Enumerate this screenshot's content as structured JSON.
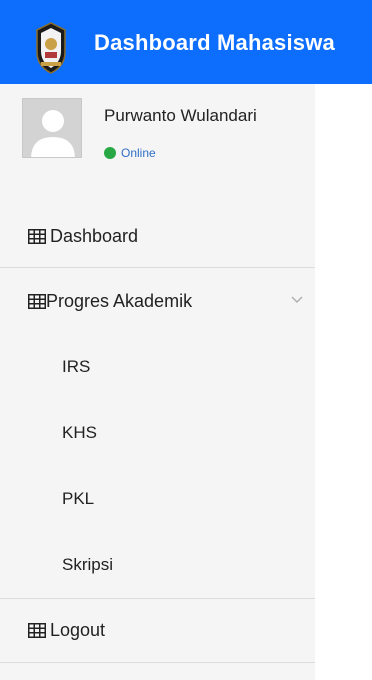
{
  "header": {
    "title": "Dashboard Mahasiswa",
    "logo_icon": "university-emblem-icon",
    "background": "#0d6efd"
  },
  "user": {
    "name": "Purwanto Wulandari",
    "status": "Online",
    "status_color": "#28a745",
    "avatar_icon": "user-avatar-icon"
  },
  "menu": {
    "dashboard_label": "Dashboard",
    "progres_label": "Progres Akademik",
    "sub_items": [
      "IRS",
      "KHS",
      "PKL",
      "Skripsi"
    ],
    "logout_label": "Logout"
  }
}
